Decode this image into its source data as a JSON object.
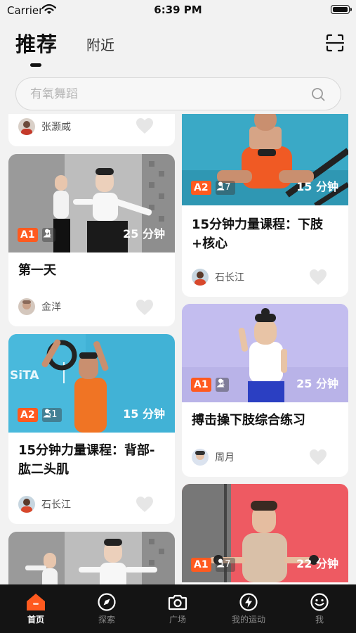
{
  "status_bar": {
    "carrier": "Carrier",
    "time": "6:39 PM"
  },
  "header": {
    "tab_recommend": "推荐",
    "tab_nearby": "附近"
  },
  "search": {
    "placeholder": "有氧舞蹈"
  },
  "cards": [
    {
      "author": "张灏威"
    },
    {
      "level": "A2",
      "participants": "17",
      "duration": "15 分钟",
      "title": "15分钟力量课程：下肢+核心",
      "author": "石长江"
    },
    {
      "level": "A1",
      "participants": "4",
      "duration": "25 分钟",
      "title": "第一天",
      "author": "金洋"
    },
    {
      "level": "A1",
      "participants": "4",
      "duration": "25 分钟",
      "title": "搏击操下肢综合练习",
      "author": "周月"
    },
    {
      "level": "A2",
      "participants": "51",
      "duration": "15 分钟",
      "title": "15分钟力量课程：背部-肱二头肌",
      "author": "石长江"
    },
    {
      "level": "A1",
      "participants": "17",
      "duration": "22 分钟",
      "title": "",
      "author": ""
    },
    {
      "level": "",
      "participants": "",
      "duration": "",
      "title": "",
      "author": ""
    }
  ],
  "thumb_text": {
    "brand": "SiTA"
  },
  "bottom_nav": [
    {
      "label": "首页",
      "icon": "home-icon",
      "active": true
    },
    {
      "label": "探索",
      "icon": "compass-icon",
      "active": false
    },
    {
      "label": "广场",
      "icon": "camera-icon",
      "active": false
    },
    {
      "label": "我的运动",
      "icon": "lightning-icon",
      "active": false
    },
    {
      "label": "我",
      "icon": "smiley-icon",
      "active": false
    }
  ],
  "colors": {
    "accent": "#ff5a1f",
    "nav_bg": "#141414",
    "page_bg": "#f2f2f2"
  }
}
